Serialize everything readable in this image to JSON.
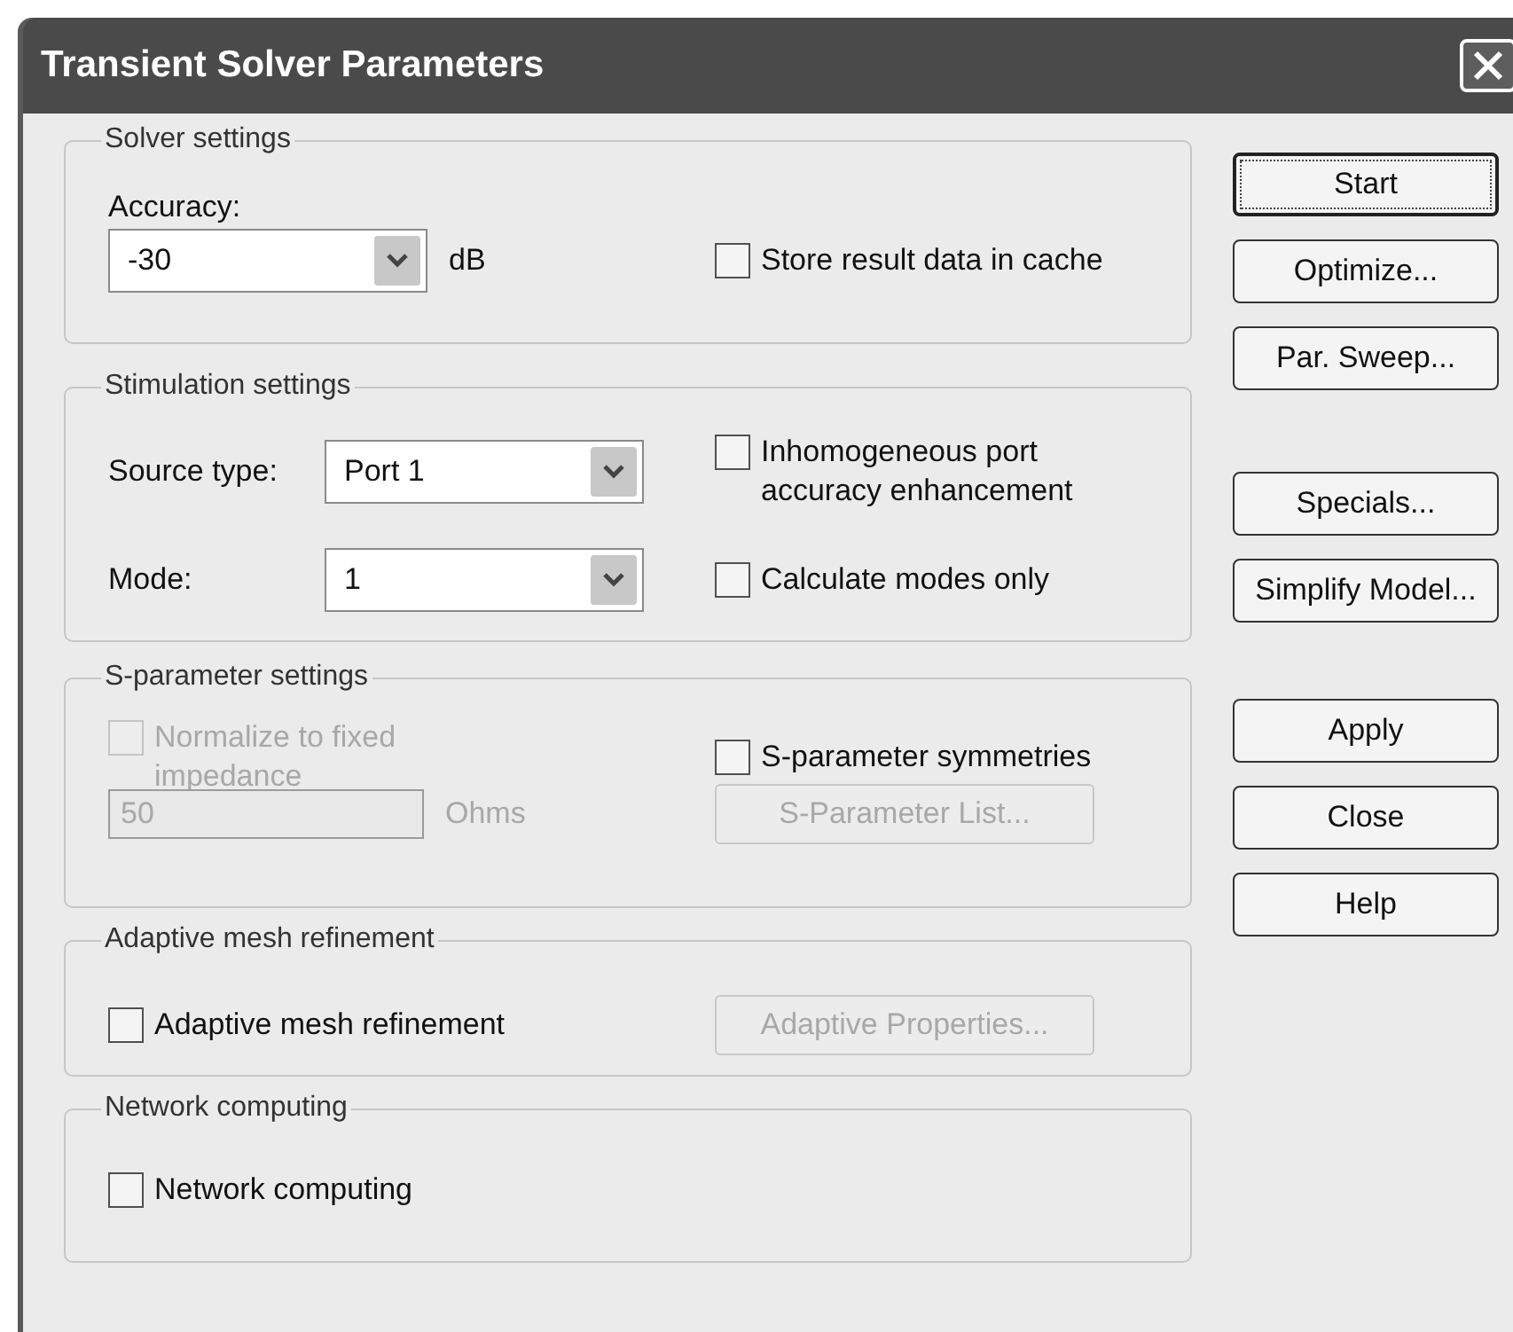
{
  "window": {
    "title": "Transient Solver Parameters"
  },
  "groups": [
    {
      "title": "Solver settings",
      "rows": [
        {
          "left": [
            {
              "kind": "label",
              "text": "Accuracy:"
            }
          ],
          "right": []
        },
        {
          "left": [
            {
              "kind": "combo",
              "value": "-30",
              "disabled": false
            },
            {
              "kind": "unit",
              "text": "dB",
              "disabled": false
            }
          ],
          "right": [
            {
              "kind": "checkbox",
              "label": "Store result data in cache",
              "checked": false,
              "disabled": false
            }
          ]
        }
      ]
    },
    {
      "title": "Stimulation settings",
      "rows": [
        {
          "left": [
            {
              "kind": "label",
              "text": "Source type:"
            },
            {
              "kind": "combo",
              "value": "Port 1",
              "disabled": false
            }
          ],
          "right": [
            {
              "kind": "checkbox",
              "label": "Inhomogeneous port accuracy enhancement",
              "checked": false,
              "disabled": false
            }
          ]
        },
        {
          "left": [
            {
              "kind": "label",
              "text": "Mode:"
            },
            {
              "kind": "combo",
              "value": "1",
              "disabled": false
            }
          ],
          "right": [
            {
              "kind": "checkbox",
              "label": "Calculate modes only",
              "checked": false,
              "disabled": false
            }
          ]
        }
      ]
    },
    {
      "title": "S-parameter settings",
      "rows": [
        {
          "left": [
            {
              "kind": "checkbox",
              "label": "Normalize to fixed impedance",
              "checked": false,
              "disabled": true
            }
          ],
          "right": [
            {
              "kind": "checkbox",
              "label": "S-parameter symmetries",
              "checked": false,
              "disabled": false
            }
          ]
        },
        {
          "left": [
            {
              "kind": "field",
              "value": "50",
              "disabled": true
            },
            {
              "kind": "unit",
              "text": "Ohms",
              "disabled": true
            }
          ],
          "right": [
            {
              "kind": "button",
              "label": "S-Parameter List...",
              "disabled": true
            }
          ]
        }
      ]
    },
    {
      "title": "Adaptive mesh refinement",
      "rows": [
        {
          "left": [
            {
              "kind": "checkbox",
              "label": "Adaptive mesh refinement",
              "checked": false,
              "disabled": false
            }
          ],
          "right": [
            {
              "kind": "button",
              "label": "Adaptive Properties...",
              "disabled": true
            }
          ]
        }
      ]
    },
    {
      "title": "Network computing",
      "rows": [
        {
          "left": [
            {
              "kind": "checkbox",
              "label": "Network computing",
              "checked": false,
              "disabled": false
            }
          ],
          "right": []
        }
      ]
    }
  ],
  "action_buttons": [
    {
      "buttons": [
        {
          "label": "Start",
          "focused": true
        },
        {
          "label": "Optimize...",
          "focused": false
        },
        {
          "label": "Par. Sweep...",
          "focused": false
        }
      ]
    },
    {
      "buttons": [
        {
          "label": "Specials...",
          "focused": false
        },
        {
          "label": "Simplify Model...",
          "focused": false
        }
      ]
    },
    {
      "buttons": [
        {
          "label": "Apply",
          "focused": false
        },
        {
          "label": "Close",
          "focused": false
        },
        {
          "label": "Help",
          "focused": false
        }
      ]
    }
  ]
}
